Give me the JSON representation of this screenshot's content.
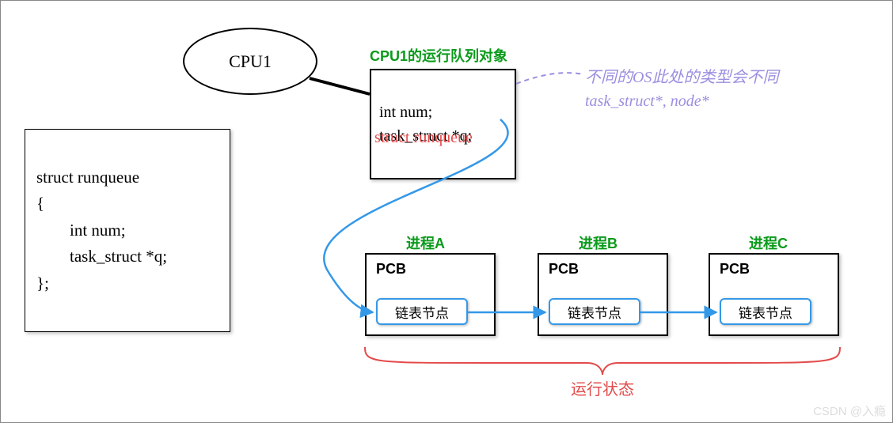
{
  "cpu": {
    "label": "CPU1"
  },
  "struct_def": {
    "line1": "struct runqueue",
    "line2": "{",
    "line3": "        int num;",
    "line4": "        task_struct *q;",
    "line5": "};"
  },
  "queue_title": "CPU1的运行队列对象",
  "queue_obj": {
    "line1": "int num;",
    "line2": "task_struct *q;"
  },
  "queue_type": "struct runqueue",
  "purple_note": {
    "line1": "不同的OS此处的类型会不同",
    "line2": "task_struct*,   node*"
  },
  "processes": [
    {
      "title": "进程A",
      "box": "PCB",
      "node": "链表节点"
    },
    {
      "title": "进程B",
      "box": "PCB",
      "node": "链表节点"
    },
    {
      "title": "进程C",
      "box": "PCB",
      "node": "链表节点"
    }
  ],
  "run_state": "运行状态",
  "watermark": "CSDN @入瘾"
}
